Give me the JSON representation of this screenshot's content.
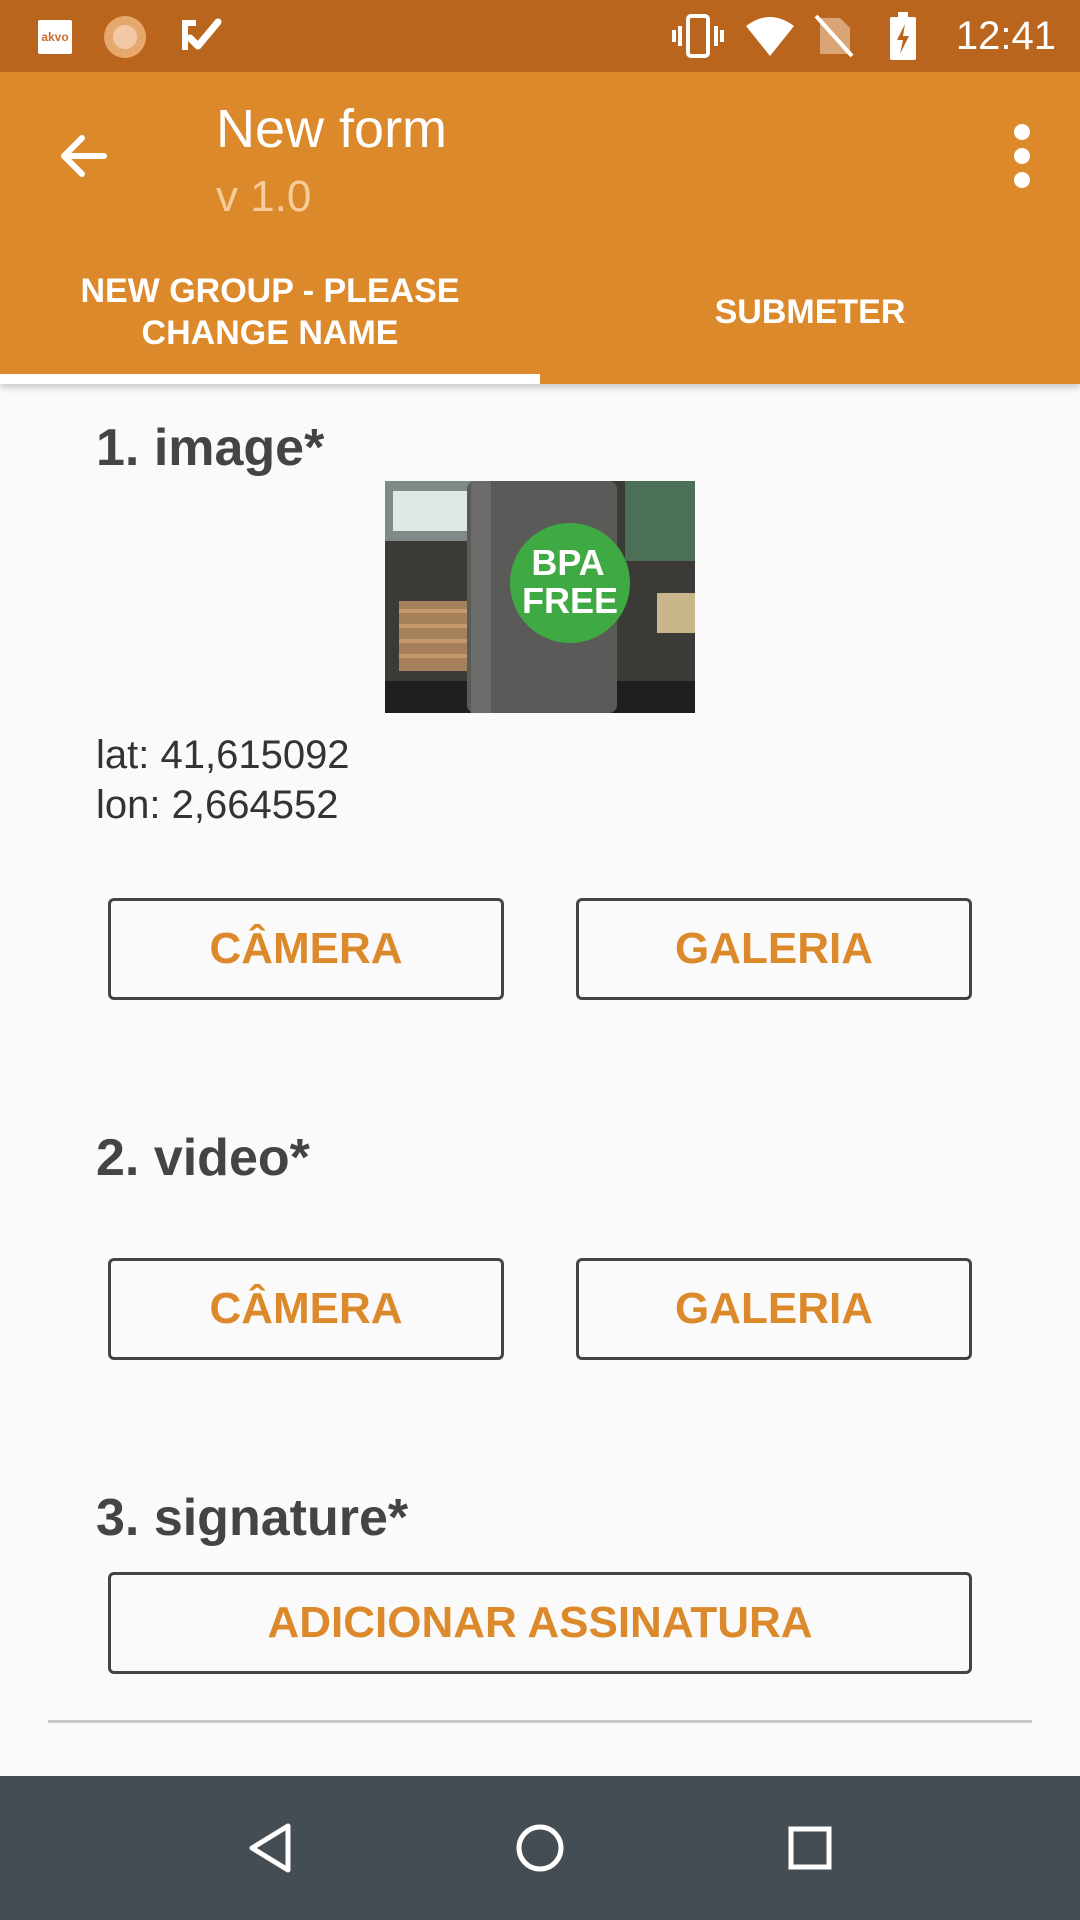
{
  "status_bar": {
    "time": "12:41",
    "notification_icons": [
      "akvo-icon",
      "clock-icon",
      "checkmark-icon"
    ],
    "system_icons": [
      "vibrate-icon",
      "wifi-icon",
      "no-sim-icon",
      "battery-charging-icon"
    ],
    "akvo_label": "akvo"
  },
  "toolbar": {
    "title": "New form",
    "version": "v 1.0",
    "back_icon": "arrow-back-icon",
    "menu_icon": "more-vert-icon"
  },
  "tabs": [
    {
      "label": "NEW GROUP - PLEASE CHANGE NAME",
      "selected": true
    },
    {
      "label": "SUBMETER",
      "selected": false
    }
  ],
  "questions": {
    "image": {
      "title": "1. image*",
      "photo_text_line1": "BPA",
      "photo_text_line2": "FREE",
      "lat": "lat: 41,615092",
      "lon": "lon: 2,664552",
      "camera_label": "CÂMERA",
      "gallery_label": "GALERIA"
    },
    "video": {
      "title": "2. video*",
      "camera_label": "CÂMERA",
      "gallery_label": "GALERIA"
    },
    "signature": {
      "title": "3. signature*",
      "add_label": "ADICIONAR ASSINATURA"
    }
  },
  "colors": {
    "accent": "#dc892b",
    "status_bar": "#b9651d",
    "nav_bar": "#454d54"
  }
}
